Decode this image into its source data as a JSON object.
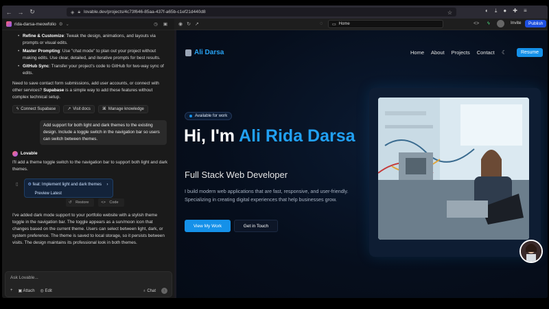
{
  "browser": {
    "url": "lovable.dev/projects/4c73f646-85aa-437f-a65b-c1ef21d440d8"
  },
  "left_panel": {
    "project_name": "rida-darsa-meowfolio",
    "bullets": [
      {
        "bold": "Refine & Customize",
        "text": ": Tweak the design, animations, and layouts via prompts or visual edits."
      },
      {
        "bold": "Master Prompting",
        "text": ": Use \"chat mode\" to plan out your project without making edits. Use clear, detailed, and iterative prompts for best results."
      },
      {
        "bold": "GitHub Sync",
        "text": ": Transfer your project's code to GitHub for two-way sync of edits."
      }
    ],
    "supabase_text_1": "Need to save contact form submissions, add user accounts, or connect with other services? ",
    "supabase_bold": "Supabase",
    "supabase_text_2": " is a simple way to add these features without complex technical setup.",
    "actions": [
      "Connect Supabase",
      "Visit docs",
      "Manage knowledge"
    ],
    "user_message": "Add support for both light and dark themes to the existing design. Include a toggle switch in the navigation bar so users can switch between themes.",
    "assistant_name": "Lovable",
    "assistant_intro": "I'll add a theme toggle switch to the navigation bar to support both light and dark themes.",
    "commit_title": "feat: Implement light and dark themes",
    "commit_preview": "Preview Latest",
    "restore_label": "Restore",
    "code_label": "Code",
    "assistant_summary": "I've added dark mode support to your portfolio website with a stylish theme toggle in the navigation bar. The toggle appears as a sun/moon icon that changes based on the current theme. Users can select between light, dark, or system preference. The theme is saved to local storage, so it persists between visits. The design maintains its professional look in both themes.",
    "input_placeholder": "Ask Lovable...",
    "attach_label": "Attach",
    "edit_label": "Edit",
    "chat_label": "Chat"
  },
  "preview_toolbar": {
    "route": "Home",
    "invite_label": "Invite",
    "publish_label": "Publish"
  },
  "site": {
    "logo_text": "Ali Darsa",
    "menu": [
      "Home",
      "About",
      "Projects",
      "Contact"
    ],
    "resume_label": "Resume",
    "badge": "Available for work",
    "hero_prefix": "Hi, I'm ",
    "hero_name": "Ali Rida Darsa",
    "subtitle": "Full Stack Web Developer",
    "description": "I build modern web applications that are fast, responsive, and user-friendly. Specializing in creating digital experiences that help businesses grow.",
    "primary_cta": "View My Work",
    "secondary_cta": "Get in Touch"
  },
  "colors": {
    "accent": "#1591e9",
    "publish": "#1d4fe0",
    "site_bg": "#060e1c"
  }
}
